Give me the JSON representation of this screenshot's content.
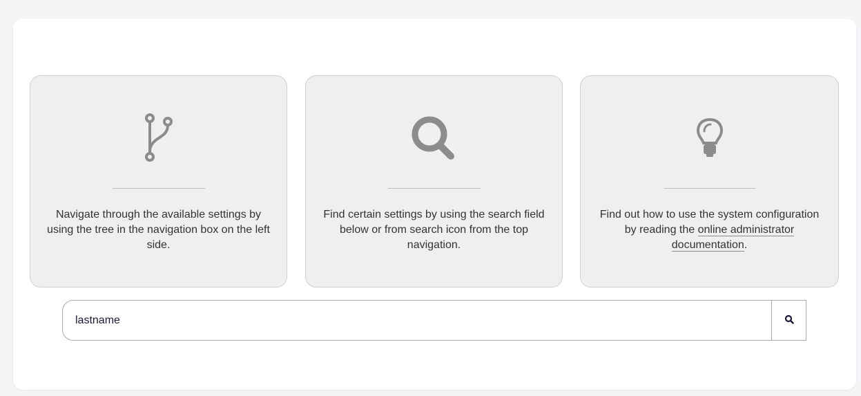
{
  "cards": [
    {
      "icon": "branch-icon",
      "text": "Navigate through the available settings by using the tree in the navigation box on the left side."
    },
    {
      "icon": "search-icon",
      "text": "Find certain settings by using the search field below or from search icon from the top navigation."
    },
    {
      "icon": "lightbulb-icon",
      "text_before": "Find out how to use the system configuration by reading the ",
      "link_text": "online administrator documentation",
      "text_after": "."
    }
  ],
  "search": {
    "value": "lastname",
    "button_icon": "search-icon"
  },
  "colors": {
    "card_background": "#efefef",
    "icon_gray": "#8c8c8c",
    "page_background": "#f4f5f7"
  }
}
